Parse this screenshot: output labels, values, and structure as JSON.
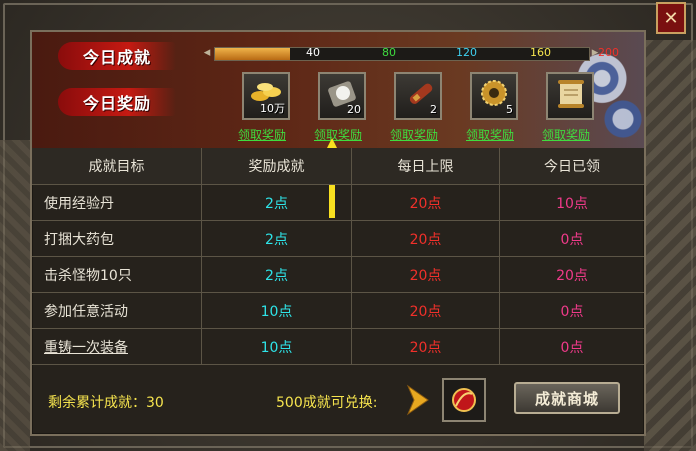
{
  "window": {
    "close_label": "✕"
  },
  "banner": {
    "achievement_title": "今日成就",
    "reward_title": "今日奖励",
    "progress_value": 40,
    "progress_max": 200,
    "ticks": [
      {
        "label": "40",
        "color": "#ffffff"
      },
      {
        "label": "80",
        "color": "#3fdc3f"
      },
      {
        "label": "120",
        "color": "#3fd0f0"
      },
      {
        "label": "160",
        "color": "#f6e44e"
      },
      {
        "label": "200",
        "color": "#f0302a"
      }
    ],
    "rewards": [
      {
        "icon": "gold-coins-icon",
        "count": "10万",
        "claim": "领取奖励"
      },
      {
        "icon": "pearl-stone-icon",
        "count": "20",
        "claim": "领取奖励"
      },
      {
        "icon": "scroll-tube-icon",
        "count": "2",
        "claim": "领取奖励"
      },
      {
        "icon": "gold-gear-medal-icon",
        "count": "5",
        "claim": "领取奖励"
      },
      {
        "icon": "ancient-scroll-icon",
        "count": "",
        "claim": "领取奖励"
      }
    ]
  },
  "table": {
    "headers": [
      "成就目标",
      "奖励成就",
      "每日上限",
      "今日已领"
    ],
    "rows": [
      {
        "goal": "使用经验丹",
        "reward": "2点",
        "limit": "20点",
        "received": "10点"
      },
      {
        "goal": "打捆大药包",
        "reward": "2点",
        "limit": "20点",
        "received": "0点"
      },
      {
        "goal": "击杀怪物10只",
        "reward": "2点",
        "limit": "20点",
        "received": "20点"
      },
      {
        "goal": "参加任意活动",
        "reward": "10点",
        "limit": "20点",
        "received": "0点"
      },
      {
        "goal": "重铸一次装备",
        "reward": "10点",
        "limit": "20点",
        "received": "0点"
      }
    ]
  },
  "footer": {
    "remaining_label": "剩余累计成就：30",
    "exchange_label": "500成就可兑换:",
    "exchange_item_icon": "red-gem-pendant-icon",
    "shop_button": "成就商城"
  }
}
